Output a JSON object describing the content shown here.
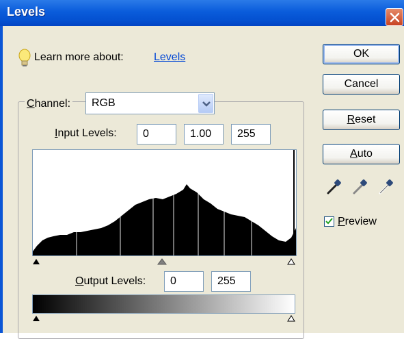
{
  "window": {
    "title": "Levels",
    "close_icon": "close-icon"
  },
  "help": {
    "prefix": "Learn more about:",
    "link": "Levels",
    "icon": "lightbulb-icon"
  },
  "channel": {
    "label": "Channel:",
    "value": "RGB"
  },
  "input_levels": {
    "label": "Input Levels:",
    "black": "0",
    "gamma": "1.00",
    "white": "255"
  },
  "output_levels": {
    "label": "Output Levels:",
    "black": "0",
    "white": "255"
  },
  "buttons": {
    "ok": "OK",
    "cancel": "Cancel",
    "reset": "Reset",
    "auto": "Auto"
  },
  "eyedroppers": [
    "black-point-eyedropper-icon",
    "gray-point-eyedropper-icon",
    "white-point-eyedropper-icon"
  ],
  "preview": {
    "label": "Preview",
    "checked": true
  },
  "colors": {
    "title_bar": "#0a5cdb",
    "client_bg": "#ece9d8",
    "link": "#0046d5",
    "close": "#c84221"
  }
}
